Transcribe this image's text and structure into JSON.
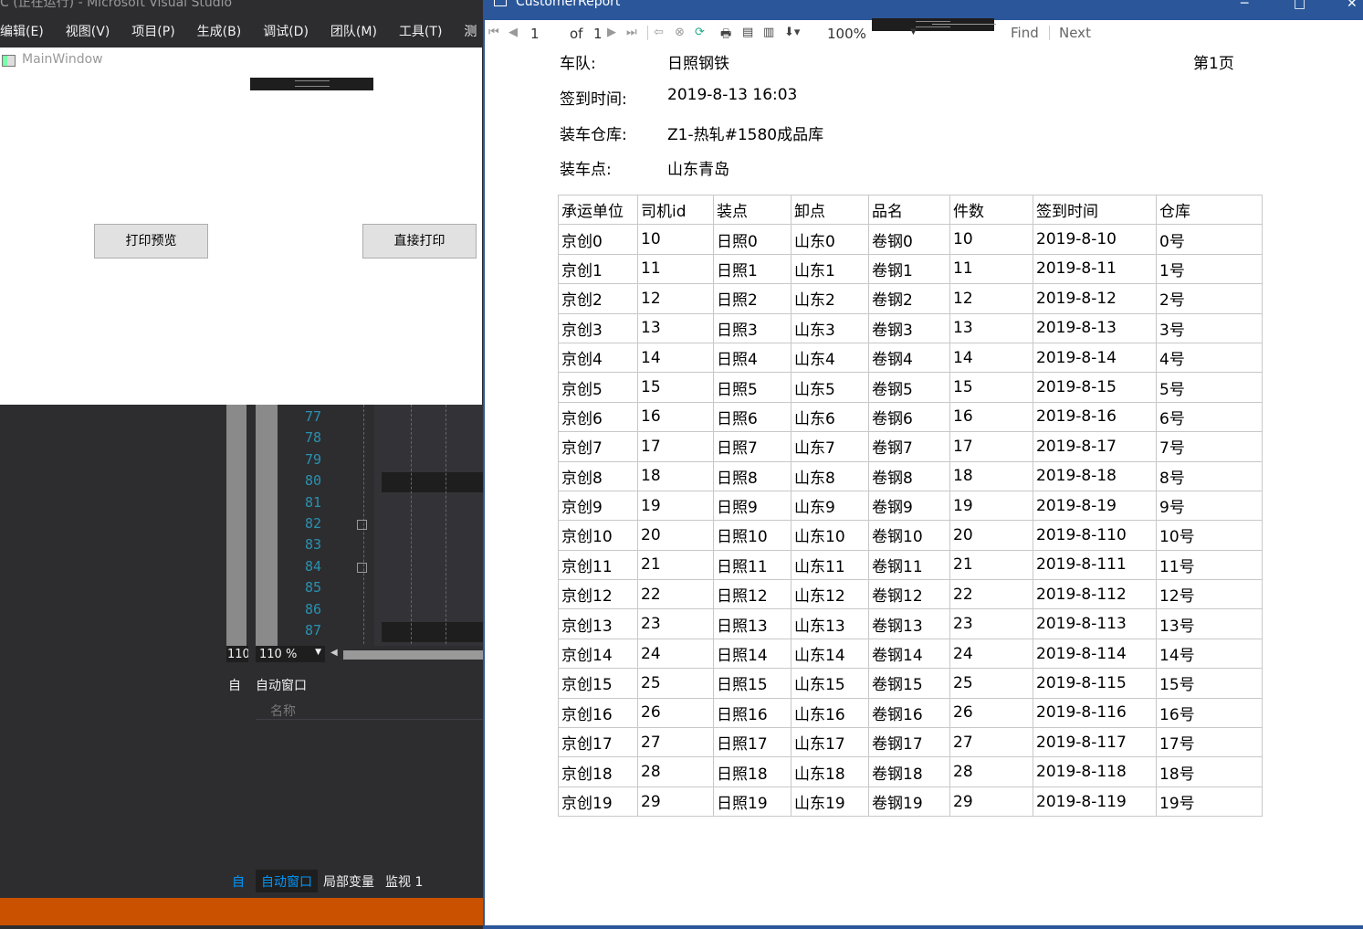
{
  "vs": {
    "title": "C (正在运行) - Microsoft Visual Studio",
    "menu": [
      "编辑(E)",
      "视图(V)",
      "项目(P)",
      "生成(B)",
      "调试(D)",
      "团队(M)",
      "工具(T)",
      "测"
    ],
    "main_window": {
      "title": "MainWindow",
      "preview_button": "打印预览",
      "print_button": "直接打印"
    },
    "line_numbers": [
      "77",
      "78",
      "79",
      "80",
      "81",
      "82",
      "83",
      "84",
      "85",
      "86",
      "87"
    ],
    "zoom": "110 %",
    "zoom_left": "110",
    "auto_panel_title": "自动窗口",
    "auto_panel_title_left": "自动",
    "auto_col_name": "名称",
    "tabs": [
      "自动窗口",
      "局部变量",
      "监视 1"
    ],
    "tab_left": "自"
  },
  "report": {
    "window_title": "CustomerReport",
    "toolbar": {
      "page": "1",
      "of_label": "of",
      "total": "1",
      "zoom": "100%",
      "find": "Find",
      "next": "Next"
    },
    "page_label": "第1页",
    "header": {
      "team_label": "车队:",
      "team_value": "日照钢铁",
      "signin_label": "签到时间:",
      "signin_value": "2019-8-13 16:03",
      "warehouse_label": "装车仓库:",
      "warehouse_value": "Z1-热轧#1580成品库",
      "point_label": "装车点:",
      "point_value": "山东青岛"
    },
    "columns": [
      "承运单位",
      "司机id",
      "装点",
      "卸点",
      "品名",
      "件数",
      "签到时间",
      "仓库"
    ],
    "rows": [
      [
        "京创0",
        "10",
        "日照0",
        "山东0",
        "卷钢0",
        "10",
        "2019-8-10",
        "0号"
      ],
      [
        "京创1",
        "11",
        "日照1",
        "山东1",
        "卷钢1",
        "11",
        "2019-8-11",
        "1号"
      ],
      [
        "京创2",
        "12",
        "日照2",
        "山东2",
        "卷钢2",
        "12",
        "2019-8-12",
        "2号"
      ],
      [
        "京创3",
        "13",
        "日照3",
        "山东3",
        "卷钢3",
        "13",
        "2019-8-13",
        "3号"
      ],
      [
        "京创4",
        "14",
        "日照4",
        "山东4",
        "卷钢4",
        "14",
        "2019-8-14",
        "4号"
      ],
      [
        "京创5",
        "15",
        "日照5",
        "山东5",
        "卷钢5",
        "15",
        "2019-8-15",
        "5号"
      ],
      [
        "京创6",
        "16",
        "日照6",
        "山东6",
        "卷钢6",
        "16",
        "2019-8-16",
        "6号"
      ],
      [
        "京创7",
        "17",
        "日照7",
        "山东7",
        "卷钢7",
        "17",
        "2019-8-17",
        "7号"
      ],
      [
        "京创8",
        "18",
        "日照8",
        "山东8",
        "卷钢8",
        "18",
        "2019-8-18",
        "8号"
      ],
      [
        "京创9",
        "19",
        "日照9",
        "山东9",
        "卷钢9",
        "19",
        "2019-8-19",
        "9号"
      ],
      [
        "京创10",
        "20",
        "日照10",
        "山东10",
        "卷钢10",
        "20",
        "2019-8-110",
        "10号"
      ],
      [
        "京创11",
        "21",
        "日照11",
        "山东11",
        "卷钢11",
        "21",
        "2019-8-111",
        "11号"
      ],
      [
        "京创12",
        "22",
        "日照12",
        "山东12",
        "卷钢12",
        "22",
        "2019-8-112",
        "12号"
      ],
      [
        "京创13",
        "23",
        "日照13",
        "山东13",
        "卷钢13",
        "23",
        "2019-8-113",
        "13号"
      ],
      [
        "京创14",
        "24",
        "日照14",
        "山东14",
        "卷钢14",
        "24",
        "2019-8-114",
        "14号"
      ],
      [
        "京创15",
        "25",
        "日照15",
        "山东15",
        "卷钢15",
        "25",
        "2019-8-115",
        "15号"
      ],
      [
        "京创16",
        "26",
        "日照16",
        "山东16",
        "卷钢16",
        "26",
        "2019-8-116",
        "16号"
      ],
      [
        "京创17",
        "27",
        "日照17",
        "山东17",
        "卷钢17",
        "27",
        "2019-8-117",
        "17号"
      ],
      [
        "京创18",
        "28",
        "日照18",
        "山东18",
        "卷钢18",
        "28",
        "2019-8-118",
        "18号"
      ],
      [
        "京创19",
        "29",
        "日照19",
        "山东19",
        "卷钢19",
        "29",
        "2019-8-119",
        "19号"
      ]
    ]
  },
  "colors": {
    "vs_bg": "#2d2d30",
    "report_title_bar": "#2b579a",
    "status_bar": "#ca5100",
    "line_number": "#2b91af",
    "active_tab": "#0097fb"
  }
}
